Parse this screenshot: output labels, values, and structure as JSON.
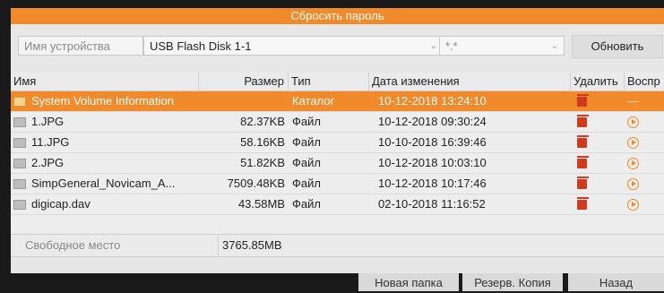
{
  "dialog": {
    "title": "Сбросить пароль"
  },
  "device": {
    "label": "Имя устройства",
    "selected": "USB Flash Disk 1-1",
    "filter": "*.*",
    "refresh_label": "Обновить"
  },
  "table": {
    "headers": {
      "name": "Имя",
      "size": "Размер",
      "type": "Тип",
      "date": "Дата изменения",
      "delete": "Удалить",
      "play": "Воспр"
    },
    "rows": [
      {
        "name": "System Volume Information",
        "size": "",
        "type": "Каталог",
        "date": "10-12-2018 13:24:10",
        "kind": "folder",
        "play": "—"
      },
      {
        "name": "1.JPG",
        "size": "82.37KB",
        "type": "Файл",
        "date": "10-12-2018 09:30:24",
        "kind": "file"
      },
      {
        "name": "11.JPG",
        "size": "58.16KB",
        "type": "Файл",
        "date": "10-10-2018 16:39:46",
        "kind": "file"
      },
      {
        "name": "2.JPG",
        "size": "51.82KB",
        "type": "Файл",
        "date": "10-12-2018 10:03:10",
        "kind": "file"
      },
      {
        "name": "SimpGeneral_Novicam_A...",
        "size": "7509.48KB",
        "type": "Файл",
        "date": "10-12-2018 10:17:46",
        "kind": "file"
      },
      {
        "name": "digicap.dav",
        "size": "43.58MB",
        "type": "Файл",
        "date": "02-10-2018 11:16:52",
        "kind": "file"
      }
    ]
  },
  "free_space": {
    "label": "Свободное место",
    "value": "3765.85MB"
  },
  "buttons": {
    "new_folder": "Новая папка",
    "backup": "Резерв. Копия",
    "back": "Назад"
  },
  "colors": {
    "accent": "#f08a2a",
    "delete": "#d03a1f"
  }
}
